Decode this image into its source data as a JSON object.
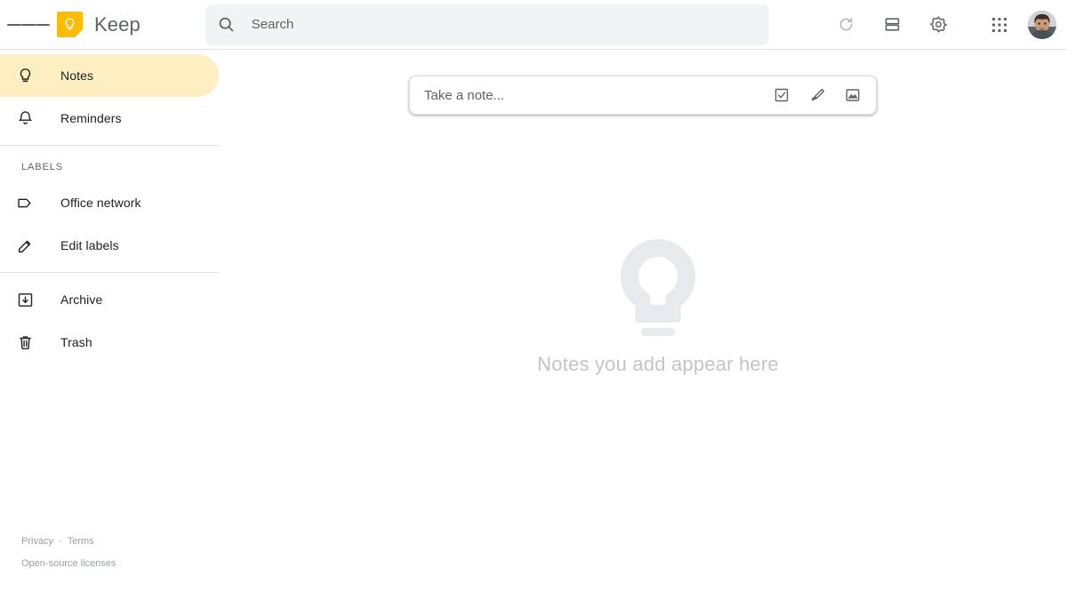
{
  "app": {
    "name": "Keep",
    "logo_color": "#fbbc04",
    "accent_active": "#feefc3"
  },
  "header": {
    "menu_icon": "hamburger-menu-icon",
    "brand_label": "Keep",
    "brand_icon": "keep-lightbulb-logo-icon",
    "search": {
      "icon": "search-icon",
      "placeholder": "Search",
      "value": ""
    },
    "actions": [
      {
        "name": "refresh-button",
        "icon": "refresh-icon"
      },
      {
        "name": "list-view-button",
        "icon": "list-view-icon"
      },
      {
        "name": "settings-button",
        "icon": "gear-icon"
      },
      {
        "name": "google-apps-button",
        "icon": "apps-grid-icon"
      }
    ],
    "avatar": {
      "name": "avatar",
      "icon": "user-avatar-photo"
    }
  },
  "sidebar": {
    "primary": [
      {
        "label": "Notes",
        "icon": "lightbulb-icon",
        "active": true
      },
      {
        "label": "Reminders",
        "icon": "bell-icon",
        "active": false
      }
    ],
    "labels_heading": "LABELS",
    "labels": [
      {
        "label": "Office network",
        "icon": "tag-icon"
      },
      {
        "label": "Edit labels",
        "icon": "pencil-icon"
      }
    ],
    "secondary": [
      {
        "label": "Archive",
        "icon": "archive-icon"
      },
      {
        "label": "Trash",
        "icon": "trash-icon"
      }
    ]
  },
  "footer": {
    "privacy": "Privacy",
    "separator": "·",
    "terms": "Terms",
    "licenses": "Open-source licenses"
  },
  "main": {
    "note_input": {
      "placeholder": "Take a note...",
      "value": "",
      "actions": [
        {
          "name": "new-list-button",
          "icon": "checkbox-icon"
        },
        {
          "name": "new-drawing-button",
          "icon": "brush-icon"
        },
        {
          "name": "new-image-note-button",
          "icon": "image-icon"
        }
      ]
    },
    "empty_state": {
      "icon": "large-lightbulb-icon",
      "text": "Notes you add appear here",
      "text_color": "#c3c5c7"
    }
  }
}
